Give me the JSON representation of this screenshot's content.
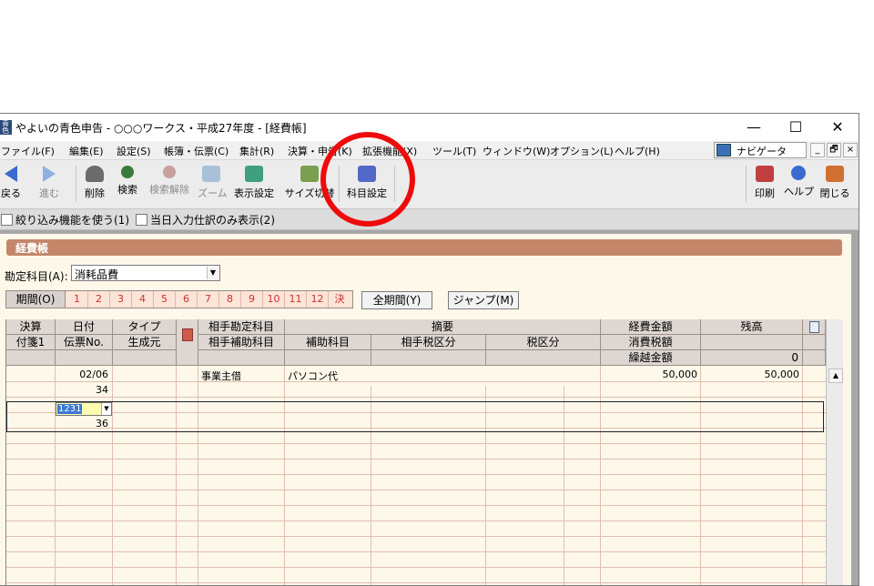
{
  "window": {
    "title": "やよいの青色申告 - ○○○ワークス・平成27年度 - [経費帳]",
    "icon_text": "青色",
    "controls": {
      "minimize": "—",
      "maximize": "☐",
      "close": "✕"
    }
  },
  "menu": {
    "items": [
      "ファイル(F)",
      "編集(E)",
      "設定(S)",
      "帳簿・伝票(C)",
      "集計(R)",
      "決算・申告(K)",
      "拡張機能(X)",
      "ツール(T)",
      "ウィンドウ(W)",
      "オプション(L)",
      "ヘルプ(H)"
    ],
    "navigator": "ナビゲータ",
    "mdi": {
      "min": "_",
      "restore": "🗗",
      "close": "×"
    }
  },
  "toolbar": {
    "back": "戻る",
    "forward": "進む",
    "delete": "削除",
    "search": "検索",
    "clear_search": "検索解除",
    "zoom": "ズーム",
    "display_settings": "表示設定",
    "size_switch": "サイズ切替",
    "account_settings": "科目設定",
    "print": "印刷",
    "help": "ヘルプ",
    "close": "閉じる",
    "colors": {
      "delete": "#6b6b6b",
      "search": "#3a7a3a",
      "clear": "#c7a0a0",
      "zoom": "#a9c0d8",
      "display": "#3f9f80",
      "size": "#7a9f50",
      "account": "#5468c8",
      "print": "#c04040",
      "help": "#3a6ad0",
      "close": "#d07030"
    }
  },
  "options": {
    "filter_label": "絞り込み機能を使う(1)",
    "today_only_label": "当日入力仕訳のみ表示(2)"
  },
  "ledger": {
    "title": "経費帳",
    "account_label": "勘定科目(A):",
    "account_value": "消耗品費",
    "period_label": "期間(O)",
    "periods": [
      "1",
      "2",
      "3",
      "4",
      "5",
      "6",
      "7",
      "8",
      "9",
      "10",
      "11",
      "12",
      "決"
    ],
    "all_period_button": "全期間(Y)",
    "jump_button": "ジャンプ(M)",
    "headers": {
      "settle": "決算",
      "date": "日付",
      "type": "タイプ",
      "counter_account": "相手勘定科目",
      "summary": "摘要",
      "expense_amount": "経費金額",
      "balance": "残高",
      "tag1": "付箋1",
      "voucher_no": "伝票No.",
      "origin": "生成元",
      "counter_sub": "相手補助科目",
      "sub_account": "補助科目",
      "counter_tax": "相手税区分",
      "tax": "税区分",
      "consumption_tax": "消費税額",
      "carryover": "繰越金額",
      "carryover_value": "0"
    },
    "rows": [
      {
        "date": "02/06",
        "voucher": "34",
        "counter_account": "事業主借",
        "summary": "パソコン代",
        "amount": "50,000",
        "balance": "50,000"
      },
      {
        "date": "1231",
        "voucher": "36"
      }
    ]
  }
}
